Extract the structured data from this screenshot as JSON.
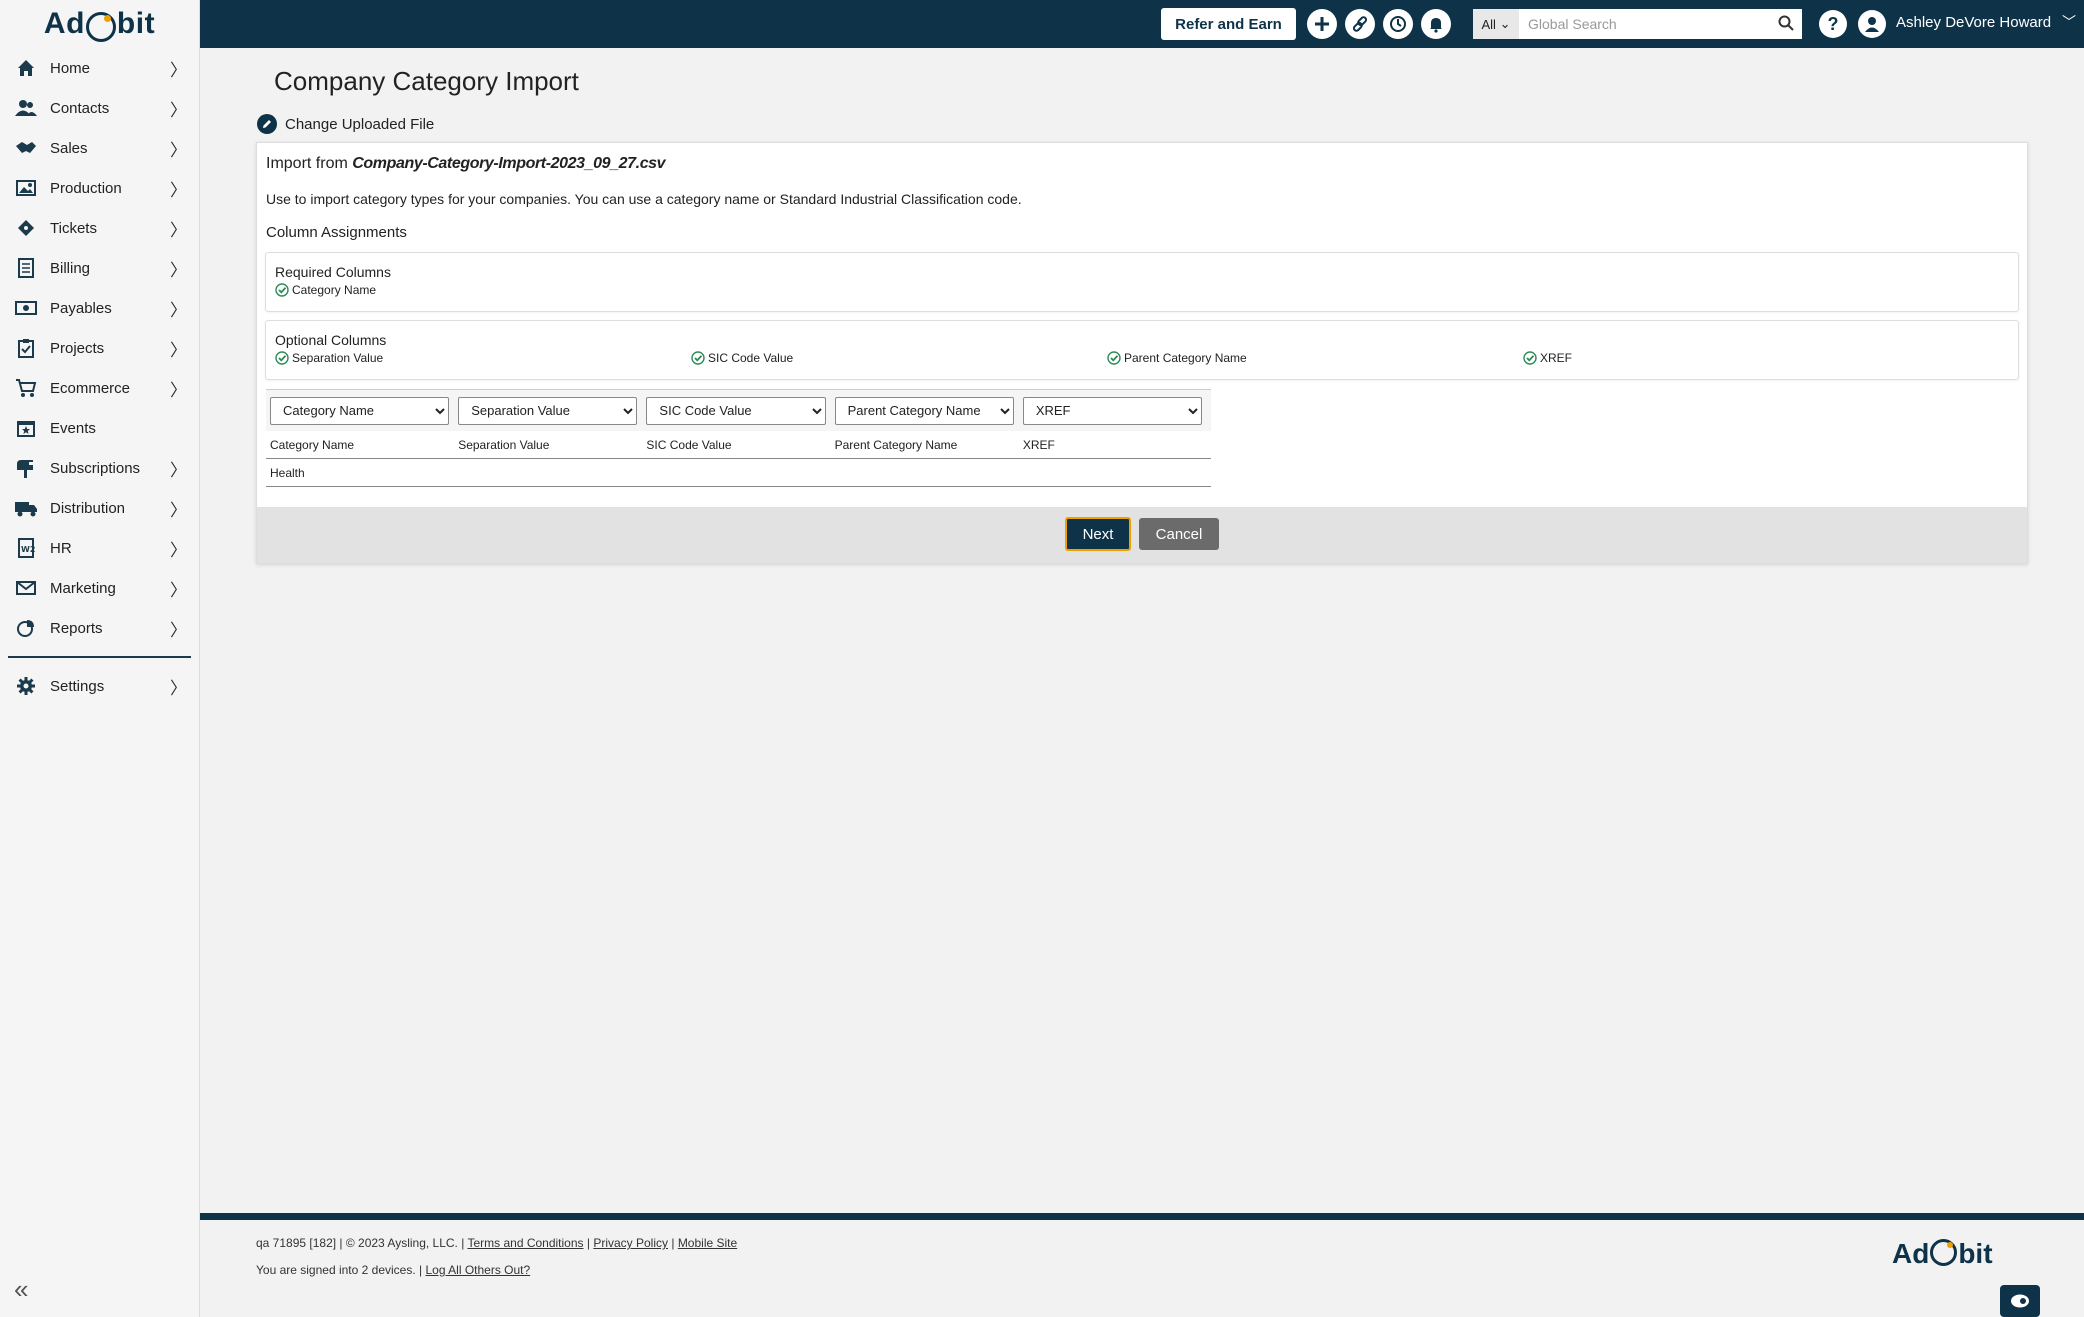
{
  "app": {
    "logo_left": "Ad",
    "logo_right": "bit"
  },
  "sidebar": {
    "items": [
      {
        "label": "Home"
      },
      {
        "label": "Contacts"
      },
      {
        "label": "Sales"
      },
      {
        "label": "Production"
      },
      {
        "label": "Tickets"
      },
      {
        "label": "Billing"
      },
      {
        "label": "Payables"
      },
      {
        "label": "Projects"
      },
      {
        "label": "Ecommerce"
      },
      {
        "label": "Events"
      },
      {
        "label": "Subscriptions"
      },
      {
        "label": "Distribution"
      },
      {
        "label": "HR"
      },
      {
        "label": "Marketing"
      },
      {
        "label": "Reports"
      }
    ],
    "settings_label": "Settings",
    "collapse_glyph": "«"
  },
  "topbar": {
    "refer_label": "Refer and Earn",
    "search_scope": "All",
    "search_placeholder": "Global Search",
    "user_name": "Ashley DeVore Howard",
    "help_glyph": "?"
  },
  "page": {
    "title": "Company Category Import",
    "change_file_label": "Change Uploaded File",
    "import_prefix": "Import from",
    "file_name": "Company-Category-Import-2023_09_27.csv",
    "description": "Use to import category types for your companies. You can use a category name or Standard Industrial Classification code.",
    "column_assignments_label": "Column Assignments",
    "required_title": "Required Columns",
    "required_columns": [
      "Category Name"
    ],
    "optional_title": "Optional Columns",
    "optional_columns": [
      "Separation Value",
      "SIC Code Value",
      "Parent Category Name",
      "XREF"
    ],
    "mapping_selects": [
      "Category Name",
      "Separation Value",
      "SIC Code Value",
      "Parent Category Name",
      "XREF"
    ],
    "mapping_headers": [
      "Category Name",
      "Separation Value",
      "SIC Code Value",
      "Parent Category Name",
      "XREF"
    ],
    "mapping_rows": [
      [
        "Health",
        "",
        "",
        "",
        ""
      ]
    ],
    "next_label": "Next",
    "cancel_label": "Cancel"
  },
  "footer": {
    "build_text": "qa 71895 [182] | © 2023 Aysling, LLC. |",
    "terms_label": "Terms and Conditions",
    "privacy_label": "Privacy Policy",
    "mobile_label": "Mobile Site",
    "signed_in_text": "You are signed into 2 devices. |",
    "log_out_label": "Log All Others Out?"
  },
  "colors": {
    "brand": "#0e3349",
    "accent": "#f0a000",
    "check": "#2e8b57"
  }
}
